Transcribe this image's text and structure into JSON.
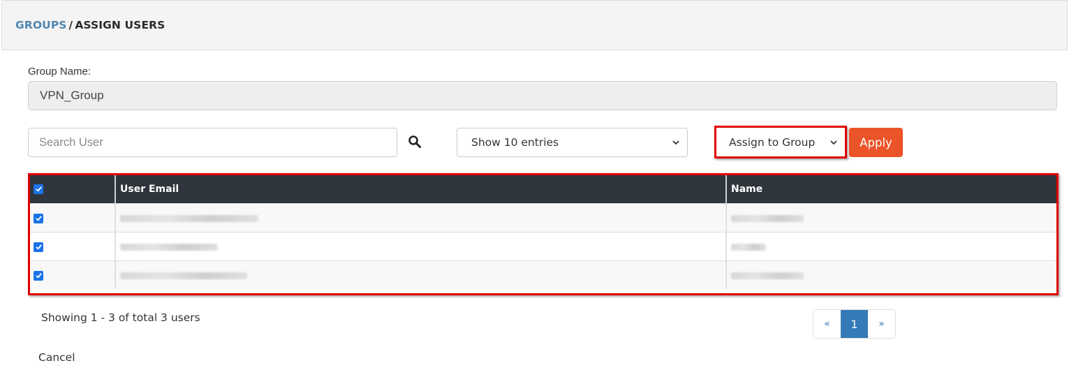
{
  "header": {
    "breadcrumb": {
      "parent": "GROUPS",
      "separator": "/",
      "current": "ASSIGN USERS"
    }
  },
  "group": {
    "label": "Group Name:",
    "value": "VPN_Group"
  },
  "toolbar": {
    "search_placeholder": "Search User",
    "search_value": "",
    "entries_select_value": "Show 10 entries",
    "action_select_value": "Assign to Group",
    "apply_label": "Apply",
    "accent_color": "#eb5328"
  },
  "table": {
    "select_all_checked": true,
    "columns": [
      "",
      "User Email",
      "Name"
    ],
    "rows": [
      {
        "checked": true,
        "email": "[redacted]",
        "name": "[redacted]"
      },
      {
        "checked": true,
        "email": "[redacted]",
        "name": "[redacted]"
      },
      {
        "checked": true,
        "email": "[redacted]",
        "name": "[redacted]"
      }
    ]
  },
  "footer": {
    "showing_text": "Showing 1 - 3 of total 3 users",
    "cancel_label": "Cancel"
  },
  "pagination": {
    "prev_label": "«",
    "current_page": "1",
    "next_label": "»"
  }
}
